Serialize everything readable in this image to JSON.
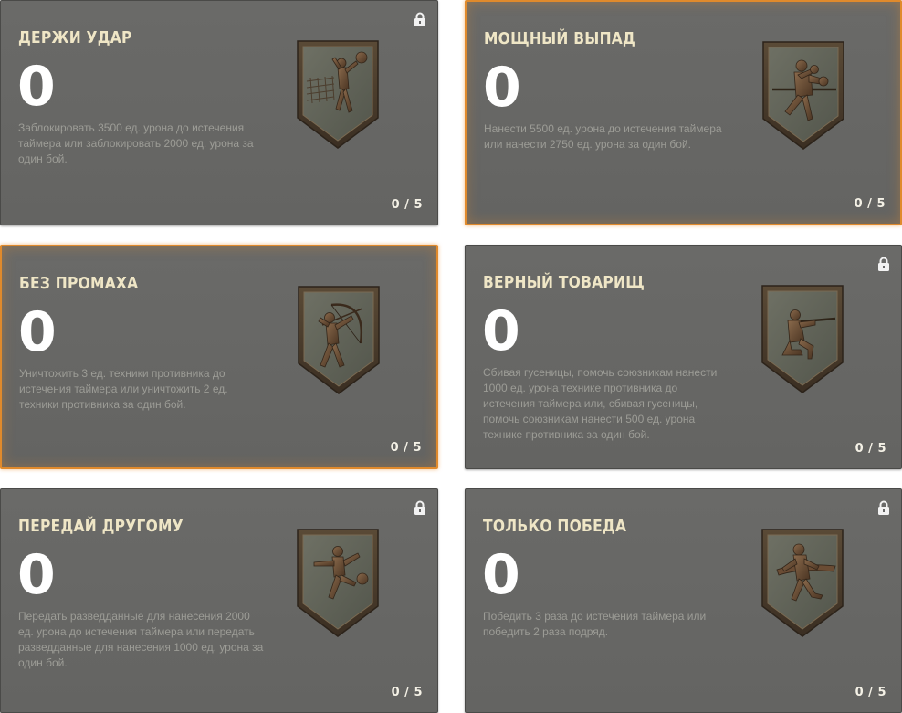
{
  "progress_max": 5,
  "cards": [
    {
      "title": "ДЕРЖИ УДАР",
      "count": "0",
      "description": "Заблокировать 3500 ед. урона до истечения таймера или заблокировать 2000 ед. урона за один бой.",
      "progress": "0 / 5",
      "locked": true,
      "highlighted": false,
      "icon": "volleyball-player-emblem-icon"
    },
    {
      "title": "МОЩНЫЙ ВЫПАД",
      "count": "0",
      "description": "Нанести 5500 ед. урона до истечения таймера или нанести 2750 ед. урона за один бой.",
      "progress": "0 / 5",
      "locked": false,
      "highlighted": true,
      "icon": "boxer-emblem-icon"
    },
    {
      "title": "БЕЗ ПРОМАХА",
      "count": "0",
      "description": "Уничтожить 3 ед. техники противника до истечения таймера или уничтожить 2 ед. техники противника за один бой.",
      "progress": "0 / 5",
      "locked": false,
      "highlighted": true,
      "icon": "archer-emblem-icon"
    },
    {
      "title": "ВЕРНЫЙ ТОВАРИЩ",
      "count": "0",
      "description": "Сбивая гусеницы, помочь союзникам нанести 1000 ед. урона технике противника до истечения таймера или, сбивая гусеницы, помочь союзникам нанести 500 ед. урона технике противника за один бой.",
      "progress": "0 / 5",
      "locked": true,
      "highlighted": false,
      "icon": "kneeling-shooter-emblem-icon"
    },
    {
      "title": "ПЕРЕДАЙ ДРУГОМУ",
      "count": "0",
      "description": "Передать разведданные для нанесения 2000 ед. урона до истечения таймера или передать разведданные для нанесения 1000 ед. урона за один бой.",
      "progress": "0 / 5",
      "locked": true,
      "highlighted": false,
      "icon": "football-player-emblem-icon"
    },
    {
      "title": "ТОЛЬКО ПОБЕДА",
      "count": "0",
      "description": "Победить 3 раза до истечения таймера или победить 2 раза подряд.",
      "progress": "0 / 5",
      "locked": true,
      "highlighted": false,
      "icon": "runner-emblem-icon"
    }
  ],
  "colors": {
    "card_bg": "#666664",
    "highlight_border": "#e08a2c",
    "title": "#efe6c6",
    "description": "#9c9c96",
    "count": "#ffffff"
  }
}
